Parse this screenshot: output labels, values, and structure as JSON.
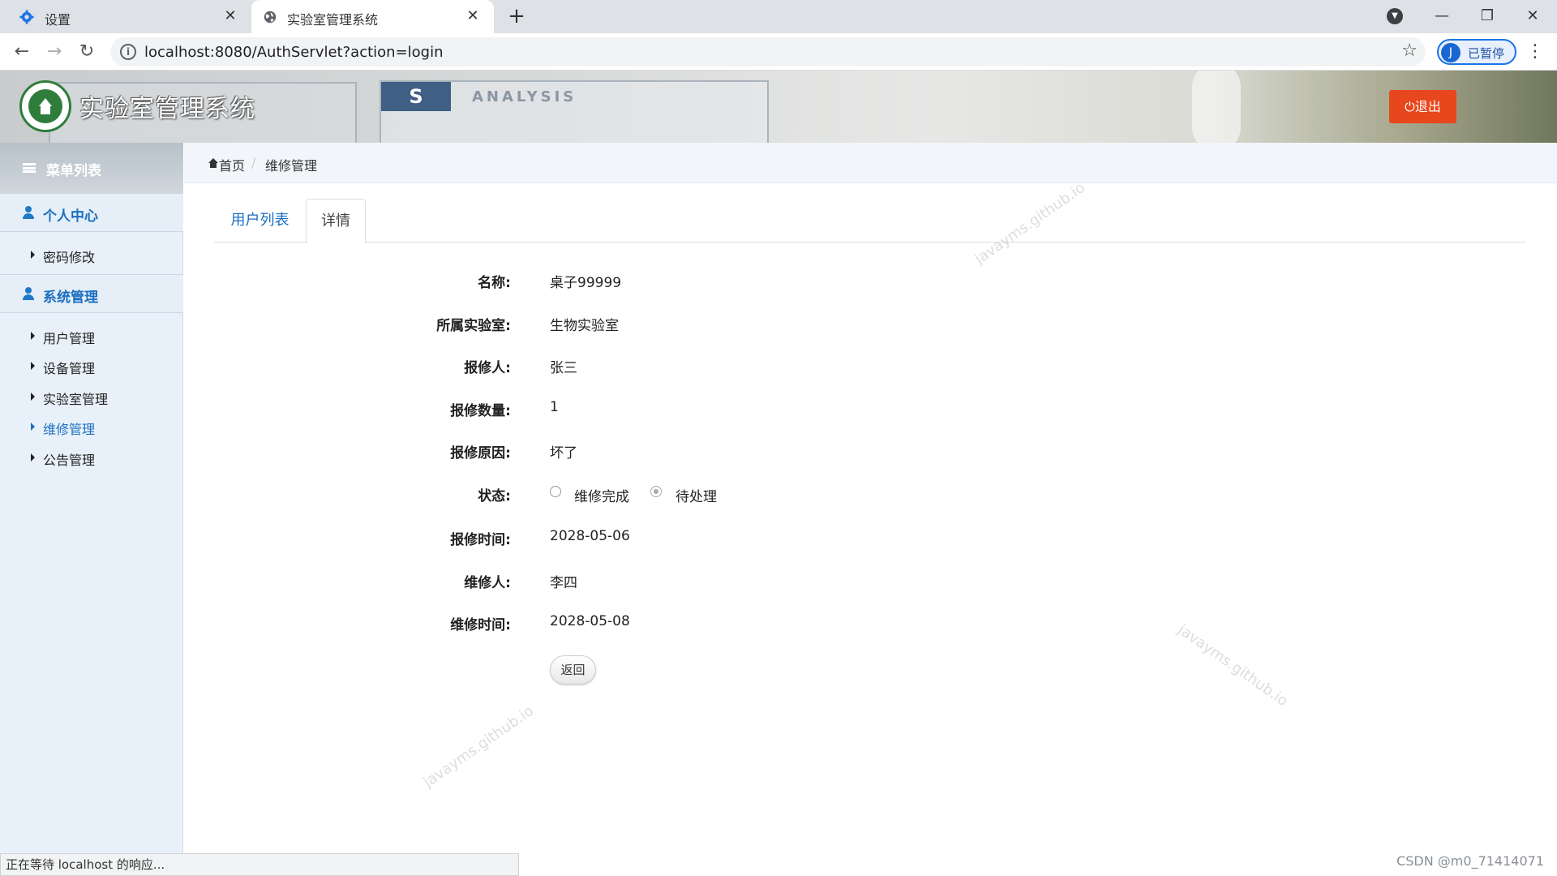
{
  "browser": {
    "tabs": [
      {
        "title": "设置",
        "icon": "gear-icon"
      },
      {
        "title": "实验室管理系统",
        "icon": "globe-icon"
      }
    ],
    "url": "localhost:8080/AuthServlet?action=login",
    "profile_initial": "J",
    "profile_status": "已暂停"
  },
  "header": {
    "app_title": "实验室管理系统",
    "logout_label": "⏻退出",
    "banner_badge": "S",
    "banner_text": "ANALYSIS"
  },
  "sidebar": {
    "heading": "菜单列表",
    "groups": [
      {
        "label": "个人中心",
        "items": [
          {
            "label": "密码修改"
          }
        ]
      },
      {
        "label": "系统管理",
        "items": [
          {
            "label": "用户管理"
          },
          {
            "label": "设备管理"
          },
          {
            "label": "实验室管理"
          },
          {
            "label": "维修管理"
          },
          {
            "label": "公告管理"
          }
        ]
      }
    ]
  },
  "breadcrumb": {
    "home": "首页",
    "current": "维修管理"
  },
  "tabs": [
    "用户列表",
    "详情"
  ],
  "detail": {
    "name": {
      "label": "名称:",
      "value": "桌子99999"
    },
    "lab": {
      "label": "所属实验室:",
      "value": "生物实验室"
    },
    "reporter": {
      "label": "报修人:",
      "value": "张三"
    },
    "quantity": {
      "label": "报修数量:",
      "value": "1"
    },
    "reason": {
      "label": "报修原因:",
      "value": "坏了"
    },
    "status": {
      "label": "状态:",
      "options": [
        "维修完成",
        "待处理"
      ],
      "selected": "待处理"
    },
    "report_time": {
      "label": "报修时间:",
      "value": "2028-05-06"
    },
    "repairer": {
      "label": "维修人:",
      "value": "李四"
    },
    "repair_time": {
      "label": "维修时间:",
      "value": "2028-05-08"
    }
  },
  "back_label": "返回",
  "watermark": "javayms.github.io",
  "status_bar": "正在等待 localhost 的响应...",
  "credit": "CSDN @m0_71414071",
  "colors": {
    "accent": "#1a6fc0",
    "logout": "#e8461c",
    "sidebar_bg": "#e8f1f9"
  }
}
